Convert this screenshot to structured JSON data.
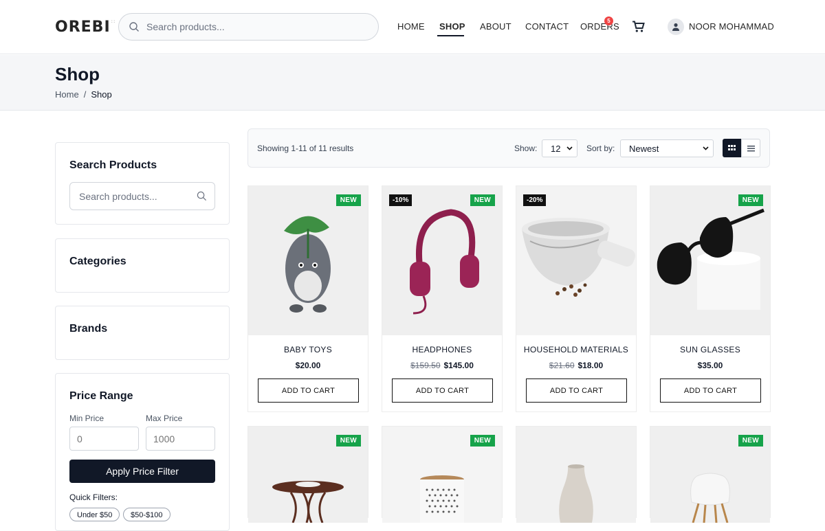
{
  "header": {
    "logo": "OREBI",
    "search_placeholder": "Search products...",
    "nav": [
      {
        "label": "HOME"
      },
      {
        "label": "SHOP"
      },
      {
        "label": "ABOUT"
      },
      {
        "label": "CONTACT"
      },
      {
        "label": "ORDERS"
      }
    ],
    "active_nav": "SHOP",
    "orders_badge": "5",
    "user_name": "NOOR MOHAMMAD"
  },
  "hero": {
    "title": "Shop",
    "breadcrumb": [
      "Home",
      "/",
      "Shop"
    ]
  },
  "sidebar": {
    "search_title": "Search Products",
    "search_placeholder": "Search products...",
    "categories_title": "Categories",
    "brands_title": "Brands",
    "price_title": "Price Range",
    "min_label": "Min Price",
    "max_label": "Max Price",
    "min_placeholder": "0",
    "max_placeholder": "1000",
    "apply_label": "Apply Price Filter",
    "quick_label": "Quick Filters:",
    "quick_filters": [
      "Under $50",
      "$50-$100"
    ]
  },
  "toolbar": {
    "results": "Showing 1-11 of 11 results",
    "show_label": "Show:",
    "show_value": "12",
    "sort_label": "Sort by:",
    "sort_value": "Newest"
  },
  "products": [
    {
      "name": "BABY TOYS",
      "price": "$20.00",
      "old_price": "",
      "tag": "NEW",
      "discount": "",
      "add": "ADD TO CART"
    },
    {
      "name": "HEADPHONES",
      "price": "$145.00",
      "old_price": "$159.50",
      "tag": "NEW",
      "discount": "-10%",
      "add": "ADD TO CART"
    },
    {
      "name": "HOUSEHOLD MATERIALS",
      "price": "$18.00",
      "old_price": "$21.60",
      "tag": "",
      "discount": "-20%",
      "add": "ADD TO CART"
    },
    {
      "name": "SUN GLASSES",
      "price": "$35.00",
      "old_price": "",
      "tag": "NEW",
      "discount": "",
      "add": "ADD TO CART"
    },
    {
      "tag": "NEW"
    },
    {
      "tag": "NEW"
    },
    {
      "tag": ""
    },
    {
      "tag": "NEW"
    }
  ],
  "colors": {
    "primary": "#111827",
    "new_tag": "#16a34a",
    "badge": "#ef4444",
    "hero_bg": "#f5f6f8"
  }
}
